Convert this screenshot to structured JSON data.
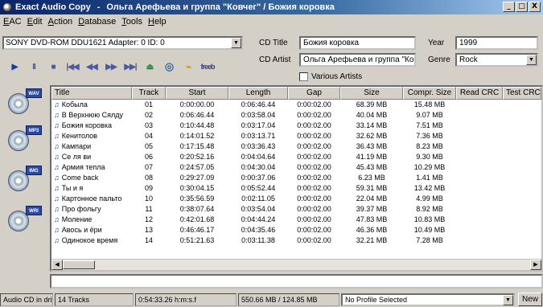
{
  "window": {
    "app_name": "Exact Audio Copy",
    "separator": "-",
    "doc_title": "Ольга Арефьева и группа \"Ковчег\" / Божия коровка",
    "btn_min": "_",
    "btn_max": "□",
    "btn_close": "X"
  },
  "menu": [
    "EAC",
    "Edit",
    "Action",
    "Database",
    "Tools",
    "Help"
  ],
  "drive": {
    "value": "SONY    DVD-ROM DDU1621   Adapter: 0  ID: 0"
  },
  "cd_info": {
    "title_label": "CD Title",
    "title_value": "Божия коровка",
    "artist_label": "CD Artist",
    "artist_value": "Ольга Арефьева и группа \"Ковч",
    "year_label": "Year",
    "year_value": "1999",
    "genre_label": "Genre",
    "genre_value": "Rock",
    "various_label": "Various Artists"
  },
  "toolbar": {
    "play": "▶",
    "pause": "II",
    "stop": "■",
    "prev": "|◀◀",
    "rewind": "◀◀",
    "forward": "▶▶",
    "next": "▶▶|",
    "eject": "⏏",
    "freedb": "freeb"
  },
  "sidebar": [
    {
      "badge": "WAV"
    },
    {
      "badge": "MP3"
    },
    {
      "badge": "IMG"
    },
    {
      "badge": "WRI"
    }
  ],
  "columns": [
    "Title",
    "Track",
    "Start",
    "Length",
    "Gap",
    "Size",
    "Compr. Size",
    "Read CRC",
    "Test CRC"
  ],
  "tracks": [
    {
      "title": "Кобыла",
      "track": "01",
      "start": "0:00:00.00",
      "length": "0:06:46.44",
      "gap": "0:00:02.00",
      "size": "68.39 MB",
      "compr": "15.48 MB"
    },
    {
      "title": "В Верхнюю Сялду",
      "track": "02",
      "start": "0:06:46.44",
      "length": "0:03:58.04",
      "gap": "0:00:02.00",
      "size": "40.04 MB",
      "compr": "9.07 MB"
    },
    {
      "title": "Божия коровка",
      "track": "03",
      "start": "0:10:44.48",
      "length": "0:03:17.04",
      "gap": "0:00:02.00",
      "size": "33.14 MB",
      "compr": "7.51 MB"
    },
    {
      "title": "Кенитолов",
      "track": "04",
      "start": "0:14:01.52",
      "length": "0:03:13.71",
      "gap": "0:00:02.00",
      "size": "32.62 MB",
      "compr": "7.36 MB"
    },
    {
      "title": "Кампари",
      "track": "05",
      "start": "0:17:15.48",
      "length": "0:03:36.43",
      "gap": "0:00:02.00",
      "size": "36.43 MB",
      "compr": "8.23 MB"
    },
    {
      "title": "Се ля ви",
      "track": "06",
      "start": "0:20:52.16",
      "length": "0:04:04.64",
      "gap": "0:00:02.00",
      "size": "41.19 MB",
      "compr": "9.30 MB"
    },
    {
      "title": "Армия тепла",
      "track": "07",
      "start": "0:24:57.05",
      "length": "0:04:30.04",
      "gap": "0:00:02.00",
      "size": "45.43 MB",
      "compr": "10.29 MB"
    },
    {
      "title": "Come back",
      "track": "08",
      "start": "0:29:27.09",
      "length": "0:00:37.06",
      "gap": "0:00:02.00",
      "size": "6.23 MB",
      "compr": "1.41 MB"
    },
    {
      "title": "Ты и я",
      "track": "09",
      "start": "0:30:04.15",
      "length": "0:05:52.44",
      "gap": "0:00:02.00",
      "size": "59.31 MB",
      "compr": "13.42 MB"
    },
    {
      "title": "Картонное пальто",
      "track": "10",
      "start": "0:35:56.59",
      "length": "0:02:11.05",
      "gap": "0:00:02.00",
      "size": "22.04 MB",
      "compr": "4.99 MB"
    },
    {
      "title": "Про фольгу",
      "track": "11",
      "start": "0:38:07.64",
      "length": "0:03:54.04",
      "gap": "0:00:02.00",
      "size": "39.37 MB",
      "compr": "8.92 MB"
    },
    {
      "title": "Моление",
      "track": "12",
      "start": "0:42:01.68",
      "length": "0:04:44.24",
      "gap": "0:00:02.00",
      "size": "47.83 MB",
      "compr": "10.83 MB"
    },
    {
      "title": "Авось и ёри",
      "track": "13",
      "start": "0:46:46.17",
      "length": "0:04:35.46",
      "gap": "0:00:02.00",
      "size": "46.36 MB",
      "compr": "10.49 MB"
    },
    {
      "title": "Одинокое время",
      "track": "14",
      "start": "0:51:21.63",
      "length": "0:03:11.38",
      "gap": "0:00:02.00",
      "size": "32.21 MB",
      "compr": "7.28 MB"
    }
  ],
  "status": {
    "drive_state": "Audio CD in drive",
    "tracks": "14 Tracks",
    "total_time": "0:54:33.26 h:m:s.f",
    "sizes": "550.66 MB / 124.85 MB",
    "profile": "No Profile Selected",
    "new_label": "New"
  }
}
